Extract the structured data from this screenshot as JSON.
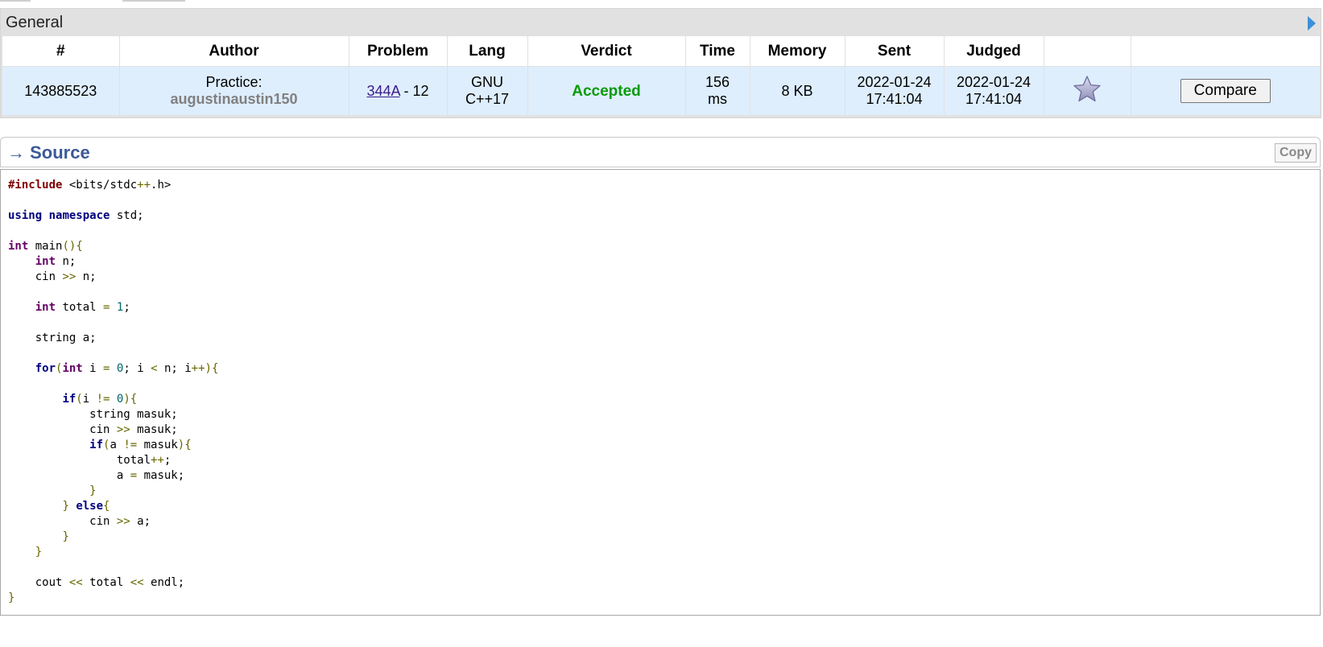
{
  "general": {
    "title": "General"
  },
  "table": {
    "headers": [
      "#",
      "Author",
      "Problem",
      "Lang",
      "Verdict",
      "Time",
      "Memory",
      "Sent",
      "Judged",
      "",
      ""
    ],
    "row": {
      "id": "143885523",
      "author_type": "Practice:",
      "author_handle": "augustinaustin150",
      "problem_link": "344A",
      "problem_suffix": " - 12",
      "lang_line1": "GNU",
      "lang_line2": "C++17",
      "verdict": "Accepted",
      "time_value": "156",
      "time_unit": "ms",
      "memory": "8 KB",
      "sent_date": "2022-01-24",
      "sent_time": "17:41:04",
      "judged_date": "2022-01-24",
      "judged_time": "17:41:04",
      "compare_label": "Compare"
    }
  },
  "source": {
    "arrow": "→",
    "title": "Source",
    "copy_label": "Copy"
  },
  "code_lines": [
    "#include <bits/stdc++.h>",
    "",
    "using namespace std;",
    "",
    "int main(){",
    "    int n;",
    "    cin >> n;",
    "",
    "    int total = 1;",
    "",
    "    string a;",
    "",
    "    for(int i = 0; i < n; i++){",
    "",
    "        if(i != 0){",
    "            string masuk;",
    "            cin >> masuk;",
    "            if(a != masuk){",
    "                total++;",
    "                a = masuk;",
    "            }",
    "        } else{",
    "            cin >> a;",
    "        }",
    "    }",
    "",
    "    cout << total << endl;",
    "}"
  ],
  "colors": {
    "accent": "#3b5998",
    "accepted": "#0a9a0a",
    "row_bg": "#deeefd"
  }
}
